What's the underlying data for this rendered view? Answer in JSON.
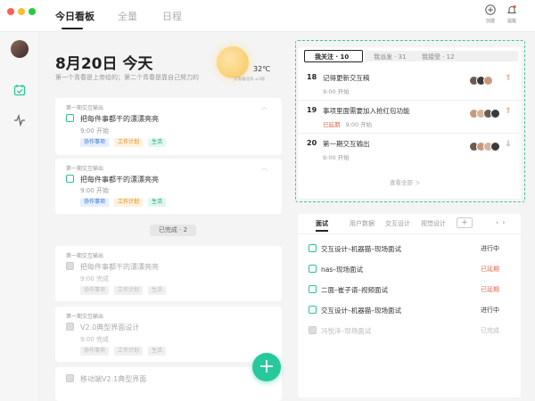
{
  "colors": {
    "accent": "#27c89c",
    "overdue": "#e5674a",
    "window_close": "#fe5f57",
    "window_min": "#febc2e",
    "window_max": "#28c840"
  },
  "header": {
    "tabs": [
      {
        "label": "今日看板"
      },
      {
        "label": "全量"
      },
      {
        "label": "日程"
      }
    ],
    "create_label": "创建",
    "remind_label": "提醒"
  },
  "sidebar": {
    "items": [
      {
        "icon": "calendar-check-icon"
      },
      {
        "icon": "pulse-icon"
      }
    ]
  },
  "today": {
    "date_title": "8月20日 今天",
    "motto": "第一个青春是上帝给的；第二个青春是靠自己努力的",
    "weather": {
      "icon": "sun-icon",
      "temp": "32℃",
      "sub": "东南偏北风  ≤3级"
    }
  },
  "todo_cards": [
    {
      "head": "第一期交互输出",
      "title": "把每件事都干的漂漂亮亮",
      "time": "9:00 开始",
      "tags": [
        "协作事项",
        "工作计划",
        "生活"
      ]
    },
    {
      "head": "第一期交互输出",
      "title": "把每件事都干的漂漂亮亮",
      "time": "9:00 开始",
      "tags": [
        "协作事项",
        "工作计划",
        "生活"
      ]
    }
  ],
  "done_toggle": "已完成 · 2",
  "done_cards": [
    {
      "head": "第一期交互输出",
      "title": "把每件事都干的漂漂亮亮",
      "time": "9:00 完成",
      "tags": [
        "协作事项",
        "工作计划",
        "生活"
      ]
    },
    {
      "head": "第一期交互输出",
      "title": "V2.0典型界面设计",
      "time": "9:00 完成",
      "tags": [
        "协作事项",
        "工作计划",
        "生活"
      ]
    },
    {
      "head": "",
      "title": "移动端V2.1典型界面",
      "time": ""
    }
  ],
  "follow": {
    "tabs": [
      {
        "label": "我关注 · 10"
      },
      {
        "label": "我派发 · 31"
      },
      {
        "label": "我接受 · 12"
      }
    ],
    "tasks": [
      {
        "num": "18",
        "title": "记得更新交互稿",
        "overdue": "",
        "time": "9:00 开始",
        "prio": "up"
      },
      {
        "num": "19",
        "title": "事项里面需要加入抢红包功能",
        "overdue": "已延期",
        "time": "9:00 开始",
        "prio": "up"
      },
      {
        "num": "20",
        "title": "第一期交互输出",
        "overdue": "",
        "time": "9:00 开始",
        "prio": "down"
      }
    ],
    "more": "查看全部 ＞"
  },
  "bottom": {
    "tabs": [
      {
        "label": "面试"
      },
      {
        "label": "用户数据"
      },
      {
        "label": "交互设计"
      },
      {
        "label": "视觉设计"
      }
    ],
    "plus": "+",
    "prev": "‹",
    "next": "›",
    "items": [
      {
        "title": "交互设计–机器猫–现场面试",
        "status": "进行中",
        "kind": "normal"
      },
      {
        "title": "nas–现场面试",
        "status": "已延期",
        "kind": "red"
      },
      {
        "title": "二面–崔子谞–视频面试",
        "status": "已延期",
        "kind": "red"
      },
      {
        "title": "交互设计–机器猫–现场面试",
        "status": "进行中",
        "kind": "normal"
      },
      {
        "title": "冯悦洋–现场面试",
        "status": "已完成",
        "kind": "done"
      }
    ]
  }
}
